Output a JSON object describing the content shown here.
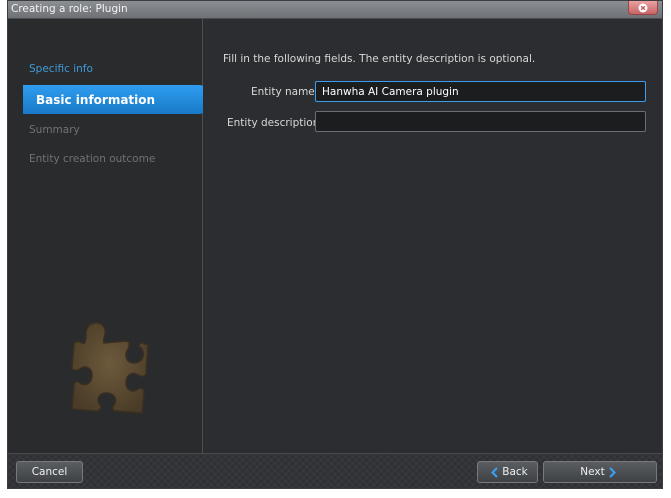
{
  "window": {
    "title": "Creating a role: Plugin"
  },
  "sidebar": {
    "section_title": "Specific info",
    "steps": [
      {
        "label": "Basic information",
        "active": true
      },
      {
        "label": "Summary",
        "active": false
      },
      {
        "label": "Entity creation outcome",
        "active": false
      }
    ],
    "illustration_icon": "puzzle-piece-icon"
  },
  "main": {
    "instructions": "Fill in the following fields. The entity description is optional.",
    "fields": {
      "name_label": "Entity name:",
      "name_value": "Hanwha AI Camera plugin",
      "description_label": "Entity description:",
      "description_value": ""
    }
  },
  "footer": {
    "cancel_label": "Cancel",
    "back_label": "Back",
    "next_label": "Next"
  },
  "colors": {
    "accent": "#2f9df0",
    "close_button": "#d46c6c",
    "background": "#2c2d30"
  }
}
